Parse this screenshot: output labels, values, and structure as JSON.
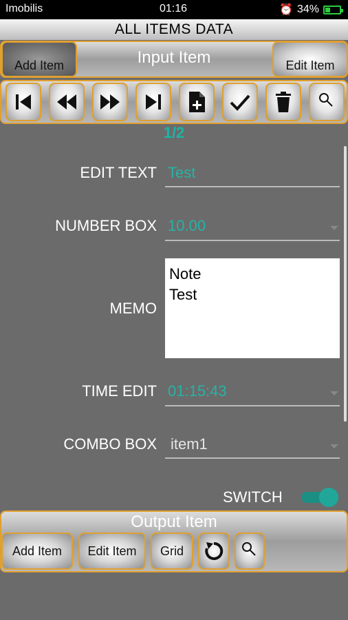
{
  "status_bar": {
    "carrier": "Imobilis",
    "time": "01:16",
    "battery": "34%",
    "battery_level": 0.34
  },
  "title": "ALL ITEMS DATA",
  "input_section": {
    "label": "Input Item",
    "add_button": "Add Item",
    "edit_button": "Edit Item"
  },
  "toolbar": {
    "icons": [
      "first-record-icon",
      "previous-record-icon",
      "next-record-icon",
      "last-record-icon",
      "new-document-icon",
      "checkmark-icon",
      "trash-icon",
      "search-icon"
    ]
  },
  "pager": "1/2",
  "form": {
    "edit_text": {
      "label": "EDIT TEXT",
      "value": "Test"
    },
    "number_box": {
      "label": "NUMBER BOX",
      "value": "10.00"
    },
    "memo": {
      "label": "MEMO",
      "lines": [
        "Note",
        "Test"
      ]
    },
    "time_edit": {
      "label": "TIME EDIT",
      "value": "01:15:43"
    },
    "combo_box": {
      "label": "COMBO BOX",
      "value": "item1"
    },
    "switch": {
      "label": "SWITCH",
      "on": true
    }
  },
  "output_section": {
    "label": "Output Item",
    "add_button": "Add Item",
    "edit_button": "Edit Item",
    "grid_button": "Grid"
  },
  "colors": {
    "accent": "#26b3a5",
    "border": "#e0a030",
    "background": "#6b6b6b"
  }
}
